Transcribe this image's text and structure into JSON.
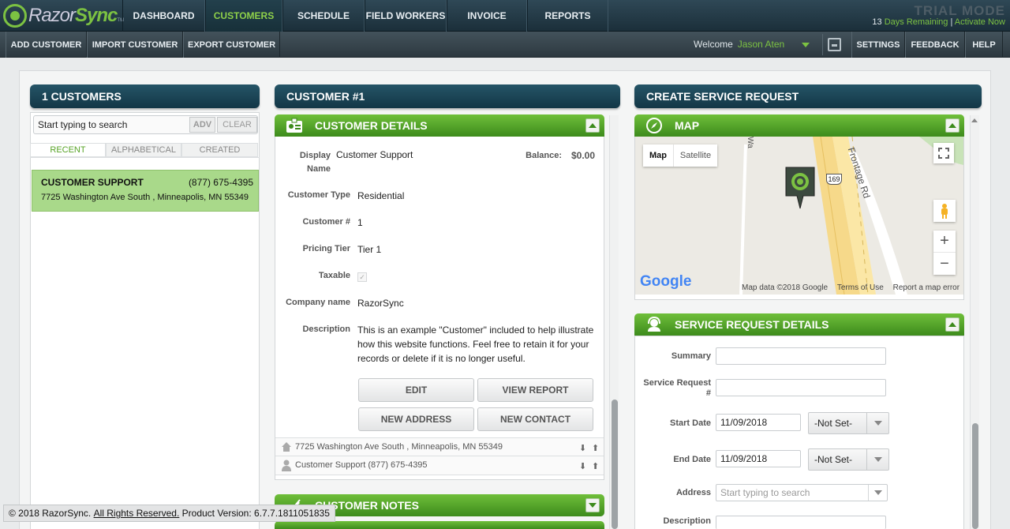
{
  "app": {
    "brand_a": "Razor",
    "brand_b": "Sync",
    "brand_tm": "TM"
  },
  "topnav": [
    {
      "label": "DASHBOARD"
    },
    {
      "label": "CUSTOMERS",
      "active": true
    },
    {
      "label": "SCHEDULE"
    },
    {
      "label": "FIELD WORKERS"
    },
    {
      "label": "INVOICE"
    },
    {
      "label": "REPORTS"
    }
  ],
  "trial": {
    "mode": "TRIAL MODE",
    "days_num": "13",
    "days_text": "Days Remaining",
    "sep": "|",
    "activate": "Activate Now"
  },
  "subnav": {
    "add": "ADD CUSTOMER",
    "import": "IMPORT CUSTOMER",
    "export": "EXPORT CUSTOMER",
    "settings": "SETTINGS",
    "feedback": "FEEDBACK",
    "help": "HELP"
  },
  "welcome": {
    "label": "Welcome",
    "name": "Jason Aten"
  },
  "left": {
    "header": "1 CUSTOMERS",
    "search_placeholder": "Start typing to search",
    "adv": "ADV",
    "clear": "CLEAR",
    "tabs": [
      "RECENT",
      "ALPHABETICAL",
      "CREATED"
    ],
    "customers": [
      {
        "name": "CUSTOMER SUPPORT",
        "phone": "(877) 675-4395",
        "address": "7725 Washington Ave South , Minneapolis, MN 55349"
      }
    ]
  },
  "middle": {
    "header": "CUSTOMER #1",
    "details_title": "CUSTOMER DETAILS",
    "fields": {
      "display_name_label": "Display Name",
      "display_name": "Customer Support",
      "balance_label": "Balance:",
      "balance": "$0.00",
      "type_label": "Customer Type",
      "type": "Residential",
      "num_label": "Customer #",
      "num": "1",
      "tier_label": "Pricing Tier",
      "tier": "Tier 1",
      "taxable_label": "Taxable",
      "company_label": "Company name",
      "company": "RazorSync",
      "desc_label": "Description",
      "desc": "This is an example \"Customer\" included to help illustrate how this website functions. Feel free to retain it for your records or delete if it is no longer useful."
    },
    "buttons": {
      "edit": "EDIT",
      "view_report": "VIEW REPORT",
      "new_address": "NEW ADDRESS",
      "new_contact": "NEW CONTACT"
    },
    "address_row": "7725 Washington Ave South , Minneapolis, MN 55349",
    "contact_row": "Customer Support (877) 675-4395",
    "notes_title": "CUSTOMER NOTES"
  },
  "right": {
    "header": "CREATE SERVICE REQUEST",
    "map_title": "MAP",
    "map": {
      "btn_map": "Map",
      "btn_sat": "Satellite",
      "road_label": "Frontage Rd",
      "shield": "169",
      "road2": "Wa",
      "google": "Google",
      "credit": "Map data ©2018 Google",
      "terms": "Terms of Use",
      "report": "Report a map error",
      "zoom_in": "+",
      "zoom_out": "−"
    },
    "srd_title": "SERVICE REQUEST DETAILS",
    "form": {
      "summary_label": "Summary",
      "sr_label": "Service Request #",
      "start_label": "Start Date",
      "start_value": "11/09/2018",
      "start_time": "-Not Set-",
      "end_label": "End Date",
      "end_value": "11/09/2018",
      "end_time": "-Not Set-",
      "address_label": "Address",
      "address_placeholder": "Start typing to search",
      "desc_label": "Description"
    }
  },
  "footer": {
    "copy": "© 2018 RazorSync.",
    "rights": "All Rights Reserved.",
    "version": "Product Version: 6.7.7.1811051835"
  },
  "colors": {
    "accent_green": "#7cc242",
    "header_teal": "#1c4657",
    "green_header": "#4fa12a",
    "selected_row": "#a9d98a"
  }
}
